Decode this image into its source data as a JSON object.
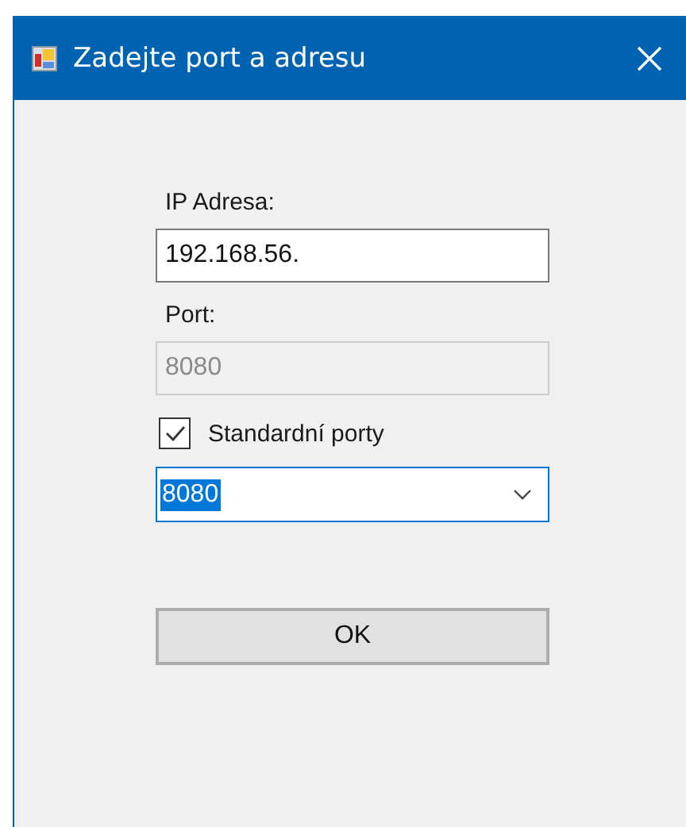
{
  "window": {
    "title": "Zadejte port a adresu"
  },
  "ip_field": {
    "label": "IP Adresa:",
    "value": "192.168.56."
  },
  "port_field": {
    "label": "Port:",
    "value": "8080",
    "disabled": true
  },
  "standard_ports": {
    "label": "Standardní porty",
    "checked": true
  },
  "port_combo": {
    "value": "8080",
    "text_selected": true,
    "focused": true
  },
  "buttons": [
    "OK"
  ]
}
